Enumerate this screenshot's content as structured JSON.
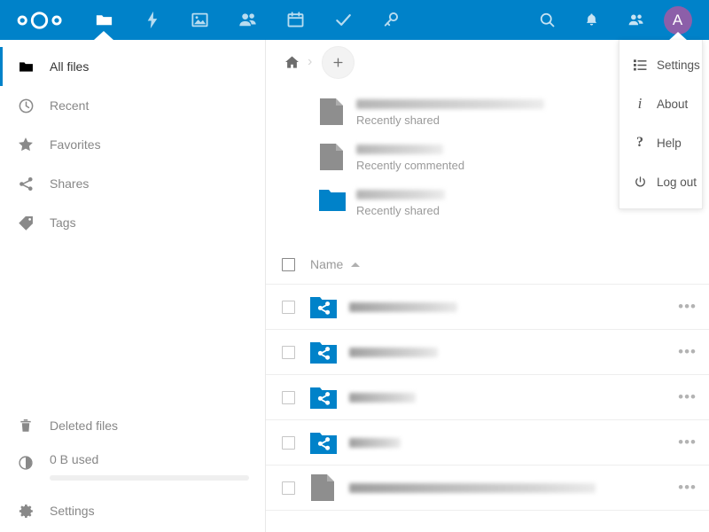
{
  "header": {
    "logo_name": "nextcloud-logo",
    "apps": [
      {
        "id": "files",
        "label": "Files",
        "icon": "folder-icon",
        "active": true
      },
      {
        "id": "activity",
        "label": "Activity",
        "icon": "lightning-icon",
        "active": false
      },
      {
        "id": "photos",
        "label": "Photos",
        "icon": "image-icon",
        "active": false
      },
      {
        "id": "contacts",
        "label": "Contacts",
        "icon": "contacts-icon",
        "active": false
      },
      {
        "id": "calendar",
        "label": "Calendar",
        "icon": "calendar-icon",
        "active": false
      },
      {
        "id": "tasks",
        "label": "Tasks",
        "icon": "checkmark-icon",
        "active": false
      },
      {
        "id": "passwords",
        "label": "Passwords",
        "icon": "key-icon",
        "active": false
      }
    ],
    "right": [
      {
        "id": "search",
        "label": "Search",
        "icon": "search-icon"
      },
      {
        "id": "notifications",
        "label": "Notifications",
        "icon": "bell-icon"
      },
      {
        "id": "contacts-menu",
        "label": "Contacts",
        "icon": "contacts-icon"
      }
    ],
    "avatar_initial": "A",
    "avatar_color": "#8c5fa9",
    "bar_color": "#0082c9"
  },
  "user_menu": {
    "open": true,
    "items": [
      {
        "label": "Settings",
        "icon": "list-settings-icon"
      },
      {
        "label": "About",
        "icon": "info-icon"
      },
      {
        "label": "Help",
        "icon": "question-mark-icon"
      },
      {
        "label": "Log out",
        "icon": "power-icon"
      }
    ]
  },
  "sidebar": {
    "items": [
      {
        "label": "All files",
        "icon": "folder-icon",
        "active": true
      },
      {
        "label": "Recent",
        "icon": "clock-icon",
        "active": false
      },
      {
        "label": "Favorites",
        "icon": "star-icon",
        "active": false
      },
      {
        "label": "Shares",
        "icon": "share-icon",
        "active": false
      },
      {
        "label": "Tags",
        "icon": "tag-icon",
        "active": false
      }
    ],
    "bottom": {
      "deleted_files": {
        "label": "Deleted files",
        "icon": "trash-icon"
      },
      "quota": {
        "label": "0 B used",
        "icon": "pie-chart-icon",
        "percent": 0
      },
      "settings": {
        "label": "Settings",
        "icon": "gear-icon"
      }
    }
  },
  "main": {
    "breadcrumb": {
      "home_icon": "home-icon",
      "separator": "›"
    },
    "new_button": {
      "label": "+",
      "name": "new-file-button"
    },
    "recents": [
      {
        "subtitle": "Recently shared",
        "icon": "file-icon",
        "icon_color": "#8e8e8e",
        "name_width": 212
      },
      {
        "subtitle": "Recently commented",
        "icon": "file-icon",
        "icon_color": "#8e8e8e",
        "name_width": 98
      },
      {
        "subtitle": "Recently shared",
        "icon": "folder-icon",
        "icon_color": "#0082c9",
        "name_width": 100
      }
    ],
    "table": {
      "columns": [
        {
          "key": "name",
          "label": "Name",
          "sort": "asc"
        }
      ],
      "select_all_checked": false,
      "rows": [
        {
          "icon": "shared-folder-icon",
          "icon_color": "#0082c9",
          "checked": false,
          "name_width": 122,
          "actions": "•••"
        },
        {
          "icon": "shared-folder-icon",
          "icon_color": "#0082c9",
          "checked": false,
          "name_width": 100,
          "actions": "•••"
        },
        {
          "icon": "shared-folder-icon",
          "icon_color": "#0082c9",
          "checked": false,
          "name_width": 75,
          "actions": "•••"
        },
        {
          "icon": "shared-folder-icon",
          "icon_color": "#0082c9",
          "checked": false,
          "name_width": 58,
          "actions": "•••"
        },
        {
          "icon": "file-icon",
          "icon_color": "#8e8e8e",
          "checked": false,
          "name_width": 278,
          "actions": "•••"
        }
      ]
    }
  }
}
